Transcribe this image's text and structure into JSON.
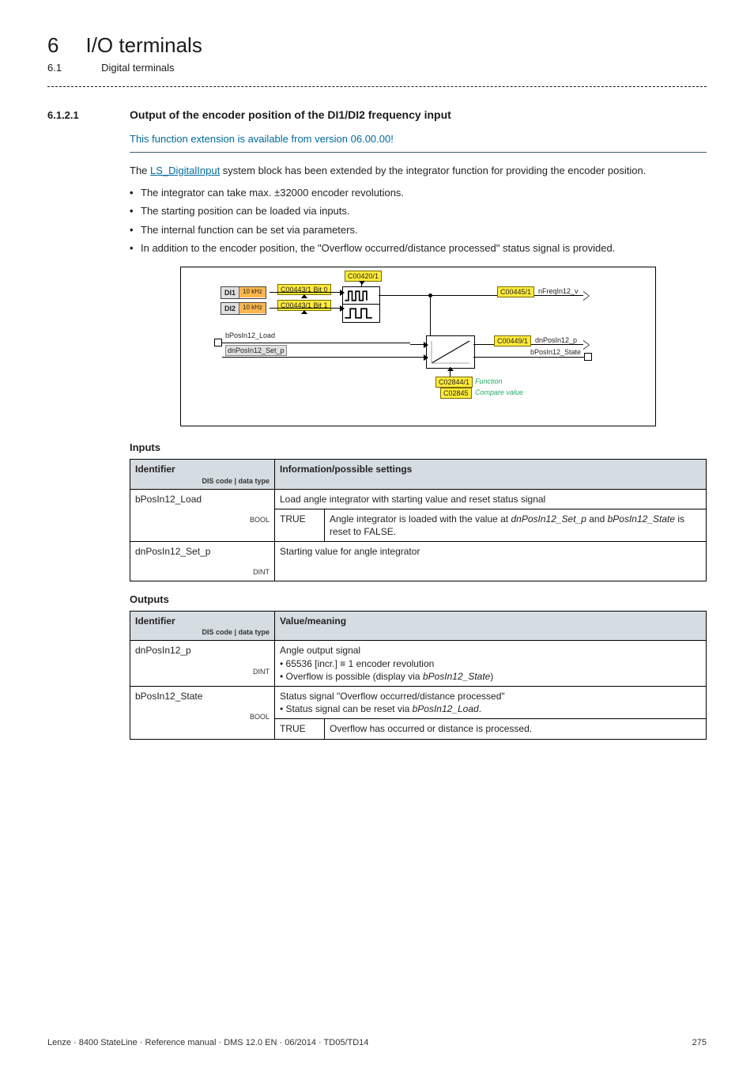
{
  "header": {
    "chapter_num": "6",
    "chapter_title": "I/O terminals",
    "section_num": "6.1",
    "section_title": "Digital terminals"
  },
  "section": {
    "num": "6.1.2.1",
    "title": "Output of the encoder position of the DI1/DI2 frequency input",
    "availability": "This function extension is available from version 06.00.00!"
  },
  "intro": {
    "pre": "The ",
    "link": "LS_DigitalInput",
    "post": " system block has been extended by the integrator function for providing the encoder position."
  },
  "bullets": [
    "The integrator can take max. ±32000 encoder revolutions.",
    "The starting position can be loaded via inputs.",
    "The internal function can be set via parameters.",
    "In addition to the encoder position, the \"Overflow occurred/distance processed\" status signal is provided."
  ],
  "diagram": {
    "di1": "DI1",
    "di2": "DI2",
    "khz": "10 kHz",
    "c00420": "C00420/1",
    "c00443_b0": "C00443/1 Bit 0",
    "c00443_b1": "C00443/1 Bit 1",
    "c00445": "C00445/1",
    "nfreq": "nFreqIn12_v",
    "bpos_load": "bPosIn12_Load",
    "dnpos_set": "dnPosIn12_Set_p",
    "c00449": "C00449/1",
    "dnpos_p": "dnPosIn12_p",
    "bpos_state": "bPosIn12_State",
    "c02844": "C02844/1",
    "c02844_t": "Function",
    "c02845": "C02845",
    "c02845_t": "Compare value"
  },
  "inputs_heading": "Inputs",
  "inputs_table": {
    "h_id": "Identifier",
    "h_dis": "DIS code | data type",
    "h_info": "Information/possible settings",
    "r1_id": "bPosIn12_Load",
    "r1_dt": "BOOL",
    "r1_desc": "Load angle integrator with starting value and reset status signal",
    "r1_k": "TRUE",
    "r1_v_a": "Angle integrator is loaded with the value at ",
    "r1_v_i1": "dnPosIn12_Set_p",
    "r1_v_b": " and ",
    "r1_v_i2": "bPosIn12_State",
    "r1_v_c": " is reset to FALSE.",
    "r2_id": "dnPosIn12_Set_p",
    "r2_dt": "DINT",
    "r2_desc": "Starting value for angle integrator"
  },
  "outputs_heading": "Outputs",
  "outputs_table": {
    "h_id": "Identifier",
    "h_dis": "DIS code | data type",
    "h_val": "Value/meaning",
    "r1_id": "dnPosIn12_p",
    "r1_dt": "DINT",
    "r1_l1": "Angle output signal",
    "r1_l2": "• 65536 [incr.] ≡ 1 encoder revolution",
    "r1_l3_a": "• Overflow is possible (display via ",
    "r1_l3_i": "bPosIn12_State",
    "r1_l3_b": ")",
    "r2_id": "bPosIn12_State",
    "r2_dt": "BOOL",
    "r2_l1": "Status signal \"Overflow occurred/distance processed\"",
    "r2_l2_a": "• Status signal can be reset via ",
    "r2_l2_i": "bPosIn12_Load",
    "r2_l2_b": ".",
    "r2_k": "TRUE",
    "r2_v": "Overflow has occurred or distance is processed."
  },
  "footer": {
    "left": "Lenze · 8400 StateLine · Reference manual · DMS 12.0 EN · 06/2014 · TD05/TD14",
    "right": "275"
  }
}
